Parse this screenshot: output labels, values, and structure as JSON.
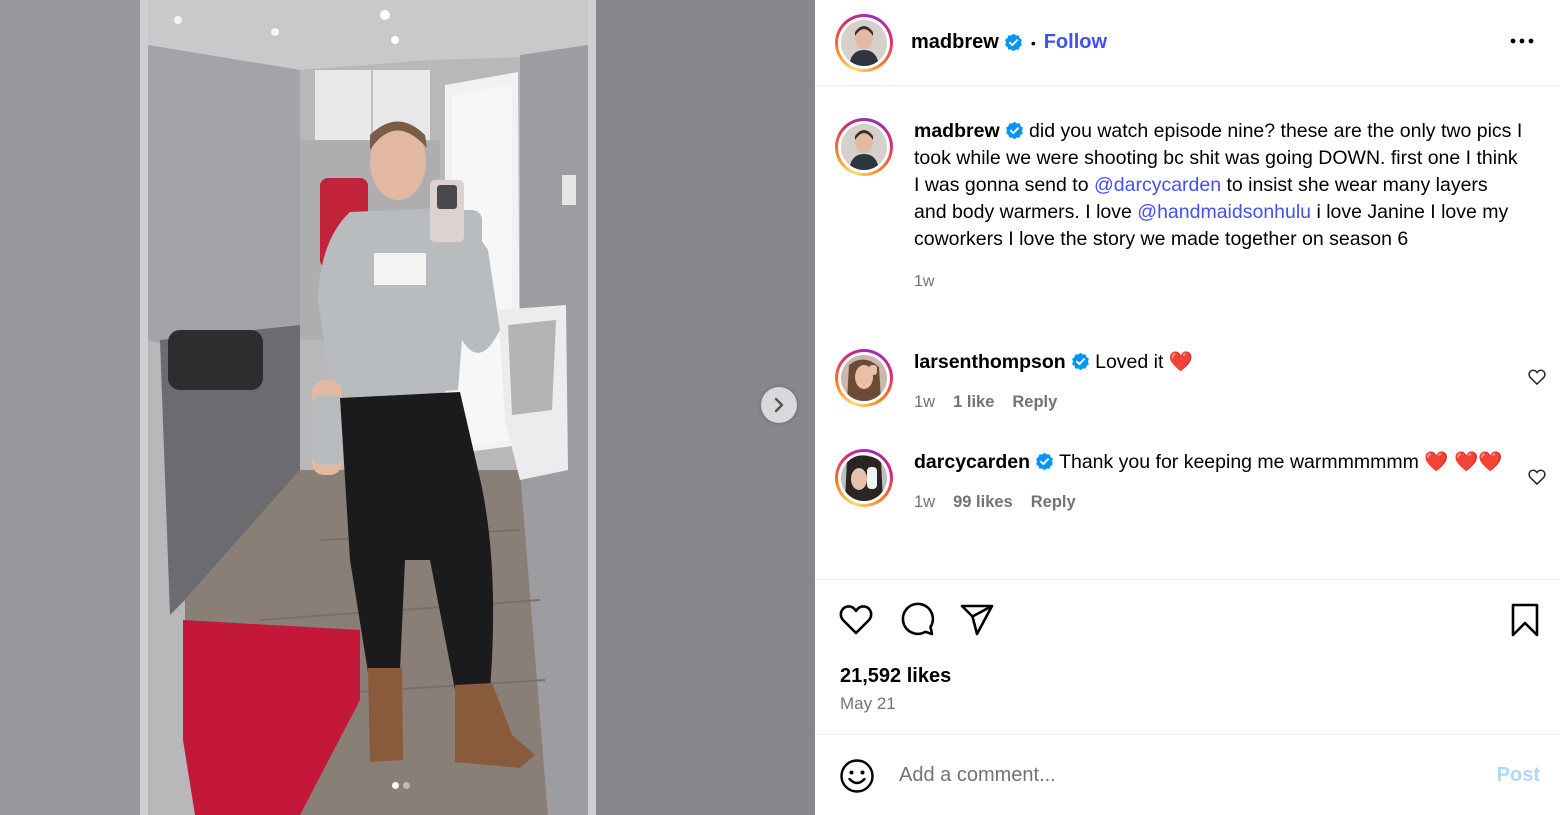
{
  "post": {
    "author": "madbrew",
    "follow_label": "Follow",
    "separator": "•",
    "more_icon": "more-horizontal-icon",
    "verified_color": "#0095f6"
  },
  "caption": {
    "author": "madbrew",
    "text_1": "did you watch episode nine? these are the only two pics I took while we were shooting bc shit was going DOWN. first one I think I was gonna send to ",
    "mention_1": "@darcycarden",
    "text_2": " to insist she wear many layers and body warmers. I love ",
    "mention_2": "@handmaidsonhulu",
    "text_3": " i love Janine I love my coworkers I love the story we made together on season 6",
    "time": "1w"
  },
  "comments": [
    {
      "author": "larsenthompson",
      "text": "Loved it ",
      "hearts": "❤️",
      "time": "1w",
      "likes": "1 like",
      "reply": "Reply"
    },
    {
      "author": "darcycarden",
      "text": "Thank you for keeping me warmmmmmm ",
      "hearts": "❤️ ❤️❤️",
      "time": "1w",
      "likes": "99 likes",
      "reply": "Reply"
    }
  ],
  "actions": {
    "like_icon": "heart-icon",
    "comment_icon": "comment-icon",
    "share_icon": "share-icon",
    "save_icon": "bookmark-icon"
  },
  "stats": {
    "likes": "21,592 likes",
    "date": "May 21"
  },
  "composer": {
    "placeholder": "Add a comment...",
    "post_label": "Post",
    "emoji_icon": "emoji-icon"
  },
  "carousel": {
    "slides_total": 2,
    "active_index": 0,
    "next_icon": "chevron-right-icon"
  },
  "colors": {
    "link": "#4150f7",
    "muted": "#737373",
    "post_disabled": "#b2d6fb",
    "heart_red": "#ff3040"
  }
}
